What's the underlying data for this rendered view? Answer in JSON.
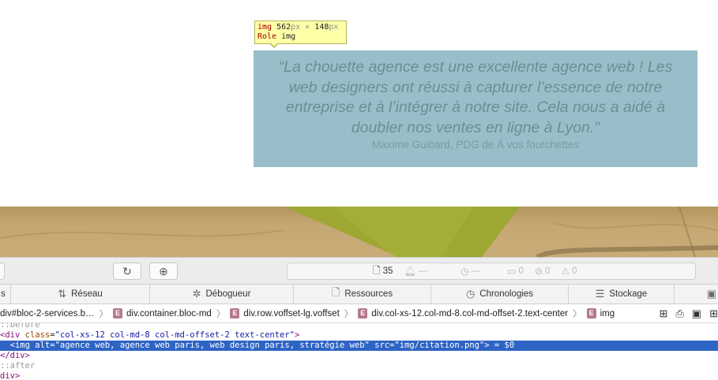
{
  "tooltip": {
    "tag": "img",
    "width": "562",
    "height": "148",
    "unit": "px",
    "times": "×",
    "role_label": "Role",
    "role_value": "img"
  },
  "quote": {
    "text": "“La chouette agence est une excellente agence web ! Les web designers ont réussi à capturer l’essence de notre entreprise et à l’intégrer à notre site. Cela nous a aidé à doubler nos ventes en ligne à Lyon.\"",
    "author": "Maxime Guibard, PDG de À vos fourchettes"
  },
  "toolbar": {
    "reload_icon": "reload-icon",
    "download_icon": "download-icon",
    "resources_count": "35",
    "status_items": [
      {
        "icon": "bell-icon",
        "label": "—"
      },
      {
        "icon": "clock-icon",
        "label": "—"
      },
      {
        "icon": "message-icon",
        "label": "0"
      },
      {
        "icon": "error-icon",
        "label": "0"
      },
      {
        "icon": "warning-icon",
        "label": "0"
      }
    ]
  },
  "tabs": [
    {
      "label": "s",
      "icon": ""
    },
    {
      "label": "Réseau",
      "icon": "network-icon"
    },
    {
      "label": "Débogueur",
      "icon": "bug-icon"
    },
    {
      "label": "Ressources",
      "icon": "file-icon"
    },
    {
      "label": "Chronologies",
      "icon": "clock-icon"
    },
    {
      "label": "Stockage",
      "icon": "storage-icon"
    }
  ],
  "breadcrumb": [
    {
      "label": "div#bloc-2-services.b…",
      "badge": false
    },
    {
      "label": "div.container.bloc-md",
      "badge": true
    },
    {
      "label": "div.row.voffset-lg.voffset",
      "badge": true
    },
    {
      "label": "div.col-xs-12.col-md-8.col-md-offset-2.text-center",
      "badge": true
    },
    {
      "label": "img",
      "badge": true
    }
  ],
  "badge_letter": "E",
  "dom": {
    "before": "::before",
    "div_open_tag": "<div",
    "div_class_attr": "class",
    "div_class_val": "\"col-xs-12 col-md-8 col-md-offset-2 text-center\"",
    "div_close_bracket": ">",
    "img_tag": "<img",
    "img_alt_attr": "alt",
    "img_alt_val": "\"agence web, agence web paris, web design paris, stratégie web\"",
    "img_src_attr": "src",
    "img_src_val": "\"img/citation.png\"",
    "img_end": "> = $0",
    "div_close": "</div>",
    "after": "::after",
    "next": "div>"
  },
  "colors": {
    "quote_bg": "#98bfc9",
    "selection": "#2e64c4",
    "tooltip_bg": "#ffffa8"
  }
}
